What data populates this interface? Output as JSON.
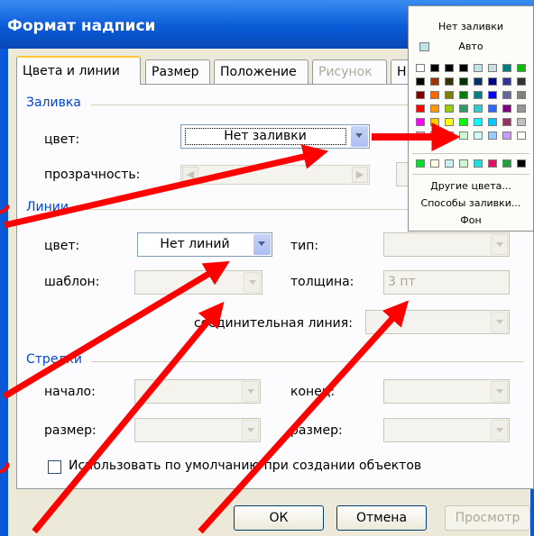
{
  "window": {
    "title": "Формат надписи"
  },
  "tabs": [
    {
      "label": "Цвета и линии"
    },
    {
      "label": "Размер"
    },
    {
      "label": "Положение"
    },
    {
      "label": "Рисунок"
    },
    {
      "label": "Н"
    }
  ],
  "fill": {
    "group_label": "Заливка",
    "color_label": "цвет:",
    "color_value": "Нет заливки",
    "transparency_label": "прозрачность:"
  },
  "lines": {
    "group_label": "Линии",
    "color_label": "цвет:",
    "color_value": "Нет линий",
    "type_label": "тип:",
    "pattern_label": "шаблон:",
    "thickness_label": "толщина:",
    "thickness_value": "3 пт",
    "connector_label": "соединительная линия:"
  },
  "arrows": {
    "group_label": "Стрелки",
    "begin_label": "начало:",
    "end_label": "конец:",
    "begin_size_label": "размер:",
    "end_size_label": "размер:"
  },
  "default_checkbox_label": "Использовать по умолчанию при создании объектов",
  "buttons": {
    "ok": "ОК",
    "cancel": "Отмена",
    "preview": "Просмотр"
  },
  "color_popup": {
    "no_fill": "Нет заливки",
    "auto": "Авто",
    "more_colors": "Другие цвета...",
    "fill_effects": "Способы заливки...",
    "background": "Фон",
    "palette_rows": [
      [
        "#ffffff",
        "#000000",
        "#000000",
        "#000000",
        "#c0e4e4",
        "#cce0e0",
        "#008080",
        "#00c000"
      ],
      [
        "#000000",
        "#993300",
        "#333300",
        "#003300",
        "#003366",
        "#000080",
        "#333399",
        "#333333"
      ],
      [
        "#800000",
        "#ff6600",
        "#808000",
        "#008000",
        "#008080",
        "#0000ff",
        "#666699",
        "#808080"
      ],
      [
        "#ff0000",
        "#ff9900",
        "#99cc00",
        "#339966",
        "#33cccc",
        "#3366ff",
        "#800080",
        "#969696"
      ],
      [
        "#ff00ff",
        "#ffcc00",
        "#ffff00",
        "#00ff00",
        "#00ffff",
        "#00ccff",
        "#993366",
        "#c0c0c0"
      ],
      [
        "#ff99cc",
        "#ffcc99",
        "#ffff99",
        "#ccffcc",
        "#ccffff",
        "#99ccff",
        "#cc99ff",
        "#ffffff"
      ]
    ],
    "recent_row": [
      "#00dd33",
      "#ffffe0",
      "#c8f0f0",
      "#d0f8d0",
      "#20e0e0",
      "#e01060",
      "#20a040",
      "#000000"
    ]
  }
}
